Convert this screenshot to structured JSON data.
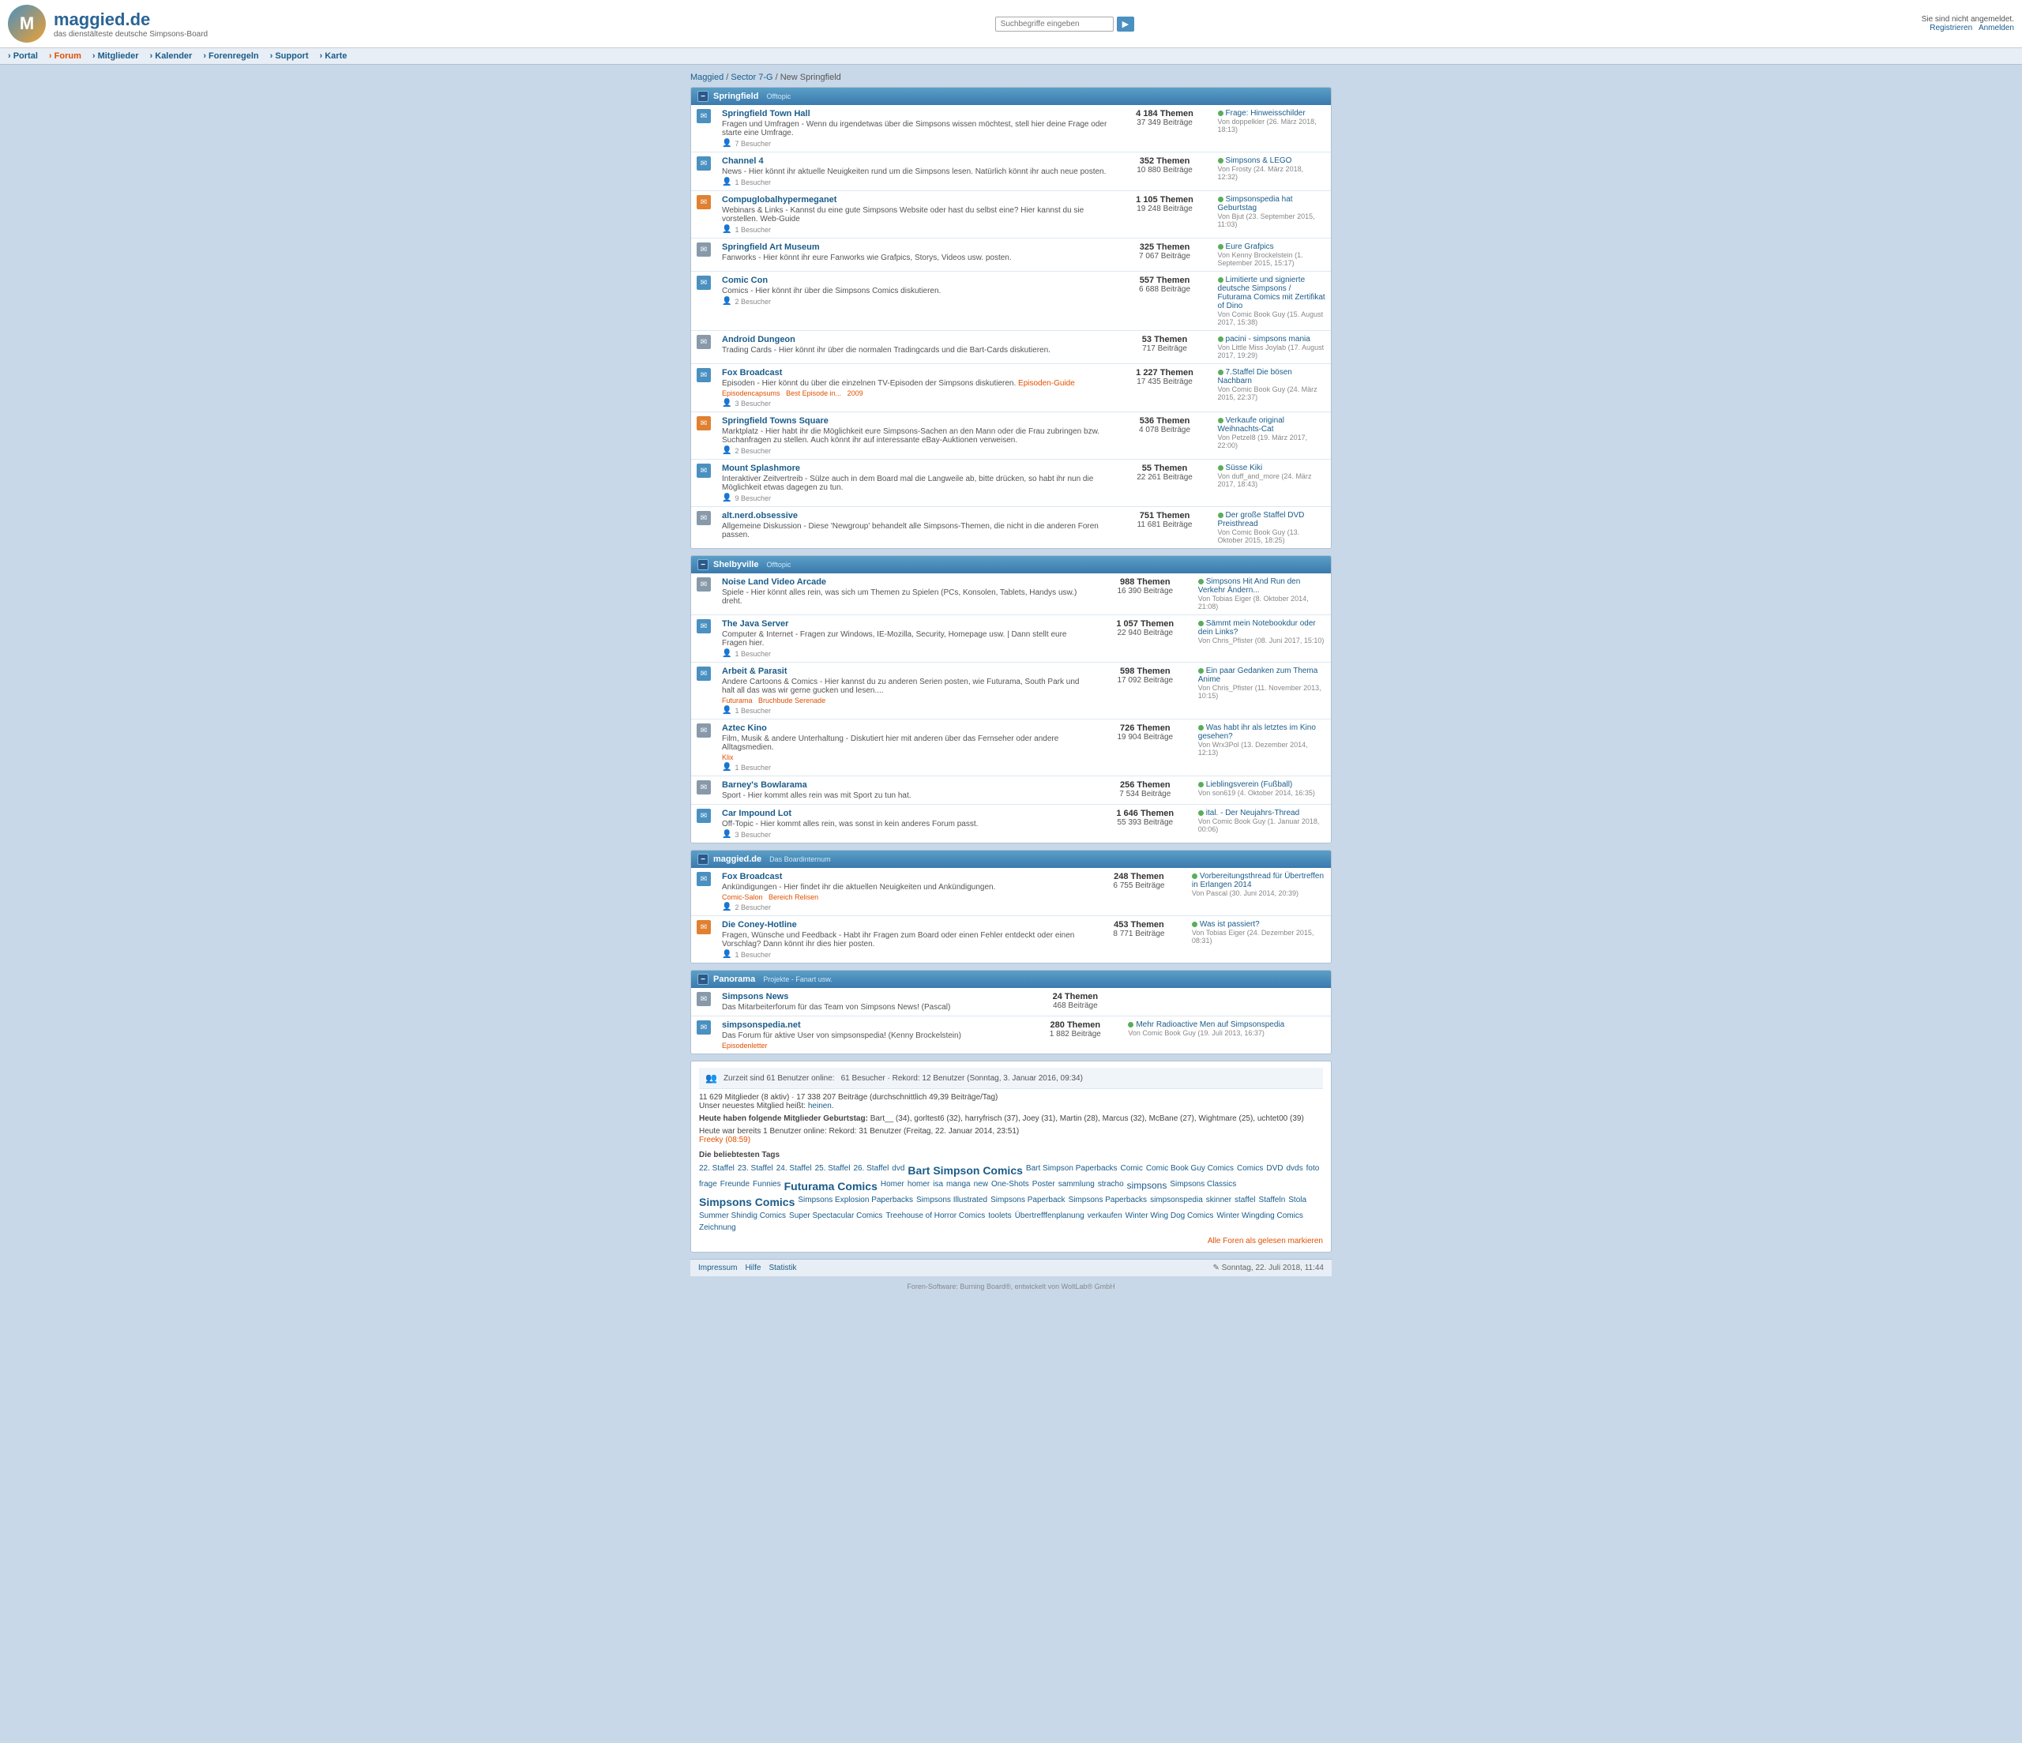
{
  "site": {
    "title": "maggied.de",
    "subtitle": "das dienstälteste deutsche Simpsons-Board",
    "search_placeholder": "Suchbegriffe eingeben",
    "not_logged_in": "Sie sind nicht angemeldet.",
    "register_link": "Registrieren",
    "login_link": "Anmelden"
  },
  "navbar": {
    "items": [
      {
        "label": "Portal",
        "href": "#",
        "active": false
      },
      {
        "label": "Forum",
        "href": "#",
        "active": true
      },
      {
        "label": "Mitglieder",
        "href": "#",
        "active": false
      },
      {
        "label": "Kalender",
        "href": "#",
        "active": false
      },
      {
        "label": "Forenregeln",
        "href": "#",
        "active": false
      },
      {
        "label": "Support",
        "href": "#",
        "active": false
      },
      {
        "label": "Karte",
        "href": "#",
        "active": false
      }
    ]
  },
  "breadcrumb": {
    "items": [
      "Maggied",
      "Sector 7-G",
      "New Springfield"
    ]
  },
  "categories": [
    {
      "id": "springfield",
      "name": "Springfield",
      "subtitle": "Offtopic",
      "forums": [
        {
          "name": "Springfield Town Hall",
          "desc": "Fragen und Umfragen - Wenn du irgendetwas über die Simpsons wissen möchtest, stell hier deine Frage oder starte eine Umfrage.",
          "users": "7 Besucher",
          "topics": "4 184 Themen",
          "posts": "37 349 Beiträge",
          "last_post_title": "Frage: Hinweisschilder",
          "last_post_meta": "Von doppelkler (26. März 2018, 18:13)"
        },
        {
          "name": "Channel 4",
          "desc": "News - Hier könnt ihr aktuelle Neuigkeiten rund um die Simpsons lesen. Natürlich könnt ihr auch neue posten.",
          "users": "1 Besucher",
          "topics": "352 Themen",
          "posts": "10 880 Beiträge",
          "last_post_title": "Simpsons & LEGO",
          "last_post_meta": "Von Frosty (24. März 2018, 12:32)"
        },
        {
          "name": "Compuglobalhypermeganet",
          "desc": "Webinars & Links - Kannst du eine gute Simpsons Website oder hast du selbst eine? Hier kannst du sie vorstellen. Web-Guide",
          "users": "1 Besucher",
          "topics": "1 105 Themen",
          "posts": "19 248 Beiträge",
          "last_post_title": "Simpsonspedia hat Geburtstag",
          "last_post_meta": "Von Bjut (23. September 2015, 11:03)"
        },
        {
          "name": "Springfield Art Museum",
          "desc": "Fanworks - Hier könnt ihr eure Fanworks wie Grafpics, Storys, Videos usw. posten.",
          "users": "",
          "topics": "325 Themen",
          "posts": "7 067 Beiträge",
          "last_post_title": "Eure Grafpics",
          "last_post_meta": "Von Kenny Brockelstein (1. September 2015, 15:17)"
        },
        {
          "name": "Comic Con",
          "desc": "Comics - Hier könnt ihr über die Simpsons Comics diskutieren.",
          "users": "2 Besucher",
          "topics": "557 Themen",
          "posts": "6 688 Beiträge",
          "last_post_title": "Limitierte und signierte deutsche Simpsons / Futurama Comics mit Zertifikat of Dino",
          "last_post_meta": "Von Comic Book Guy (15. August 2017, 15:38)"
        },
        {
          "name": "Android Dungeon",
          "desc": "Trading Cards - Hier könnt ihr über die normalen Tradingcards und die Bart-Cards diskutieren.",
          "users": "",
          "topics": "53 Themen",
          "posts": "717 Beiträge",
          "last_post_title": "pacini - simpsons mania",
          "last_post_meta": "Von Little Miss Joylab (17. August 2017, 19:29)"
        },
        {
          "name": "Fox Broadcast",
          "desc": "Episoden - Hier könnt du über die einzelnen TV-Episoden der Simpsons diskutieren. Episoden-Guide",
          "users": "3 Besucher",
          "topics": "1 227 Themen",
          "posts": "17 435 Beiträge",
          "last_post_title": "7.Staffel Die bösen Nachbarn",
          "last_post_meta": "Von Comic Book Guy (24. März 2015, 22:37)",
          "sub_links": [
            "Episodencapsums",
            "Best Episode in...",
            "2009"
          ]
        },
        {
          "name": "Springfield Towns Square",
          "desc": "Marktplatz - Hier habt ihr die Möglichkeit eure Simpsons-Sachen an den Mann oder die Frau zubringen bzw. Suchanfragen zu stellen. Auch könnt ihr auf interessante eBay-Auktionen verweisen.",
          "users": "2 Besucher",
          "topics": "536 Themen",
          "posts": "4 078 Beiträge",
          "last_post_title": "Verkaufe original Weihnachts-Cat",
          "last_post_meta": "Von Petzel8 (19. März 2017, 22:00)"
        },
        {
          "name": "Mount Splashmore",
          "desc": "Interaktiver Zeitvertreib - Sülze auch in dem Board mal die Langweile ab, bitte drücken, so habt ihr nun die Möglichkeit etwas dagegen zu tun.",
          "users": "9 Besucher",
          "topics": "55 Themen",
          "posts": "22 261 Beiträge",
          "last_post_title": "Süsse Kiki",
          "last_post_meta": "Von duff_and_more (24. März 2017, 18:43)"
        },
        {
          "name": "alt.nerd.obsessive",
          "desc": "Allgemeine Diskussion - Diese 'Newgroup' behandelt alle Simpsons-Themen, die nicht in die anderen Foren passen.",
          "users": "",
          "topics": "751 Themen",
          "posts": "11 681 Beiträge",
          "last_post_title": "Der große Staffel DVD Preisthread",
          "last_post_meta": "Von Comic Book Guy (13. Oktober 2015, 18:25)"
        }
      ]
    },
    {
      "id": "shelbyville",
      "name": "Shelbyville",
      "subtitle": "Offtopic",
      "forums": [
        {
          "name": "Noise Land Video Arcade",
          "desc": "Spiele - Hier könnt alles rein, was sich um Themen zu Spielen (PCs, Konsolen, Tablets, Handys usw.) dreht.",
          "users": "",
          "topics": "988 Themen",
          "posts": "16 390 Beiträge",
          "last_post_title": "Simpsons Hit And Run den Verkehr Ändern und die Leute neu rumzulfen in Charaktere ändern",
          "last_post_meta": "Von Tobias Eiger (8. Oktober 2014, 21:08)"
        },
        {
          "name": "The Java Server",
          "desc": "Computer & Internet - Fragen zur Windows, IE-Mozilla, Security, Homepage usw. | Dann stellt eure Fragen hier.",
          "users": "1 Besucher",
          "topics": "1 057 Themen",
          "posts": "22 940 Beiträge",
          "last_post_title": "Sämmt mein Notebookdur oder dein Links?",
          "last_post_meta": "Von Chris_Pfister (08. Juni 2017, 15:10)"
        },
        {
          "name": "Arbeit & Parasit",
          "desc": "Andere Cartoons & Comics - Hier kannst du zu anderen Serien posten, wie Futurama, South Park und halt all das was wir gerne gucken und lesen....",
          "users": "1 Besucher",
          "topics": "598 Themen",
          "posts": "17 092 Beiträge",
          "last_post_title": "Ein paar Gedanken zum Thema Anime",
          "last_post_meta": "Von Chris_Pfister (11. November 2013, 10:15)",
          "sub_links": [
            "Futurama",
            "Bruchbude Serenade"
          ]
        },
        {
          "name": "Aztec Kino",
          "desc": "Film, Musik & andere Unterhaltung - Diskutiert hier mit anderen über das Fernseher oder andere Alltagsmedien.",
          "users": "1 Besucher",
          "topics": "726 Themen",
          "posts": "19 904 Beiträge",
          "last_post_title": "Was habt ihr als letztes im Kino gesehen?",
          "last_post_meta": "Von Wrx3Pol (13. Dezember 2014, 12:13)",
          "sub_links": [
            "Klix"
          ]
        },
        {
          "name": "Barney's Bowlarama",
          "desc": "Sport - Hier kommt alles rein was mit Sport zu tun hat.",
          "users": "",
          "topics": "256 Themen",
          "posts": "7 534 Beiträge",
          "last_post_title": "Lieblingsverein (Fußball)",
          "last_post_meta": "Von son619 (4. Oktober 2014, 16:35)"
        },
        {
          "name": "Car Impound Lot",
          "desc": "Off-Topic - Hier kommt alles rein, was sonst in kein anderes Forum passt.",
          "users": "3 Besucher",
          "topics": "1 646 Themen",
          "posts": "55 393 Beiträge",
          "last_post_title": "ital. - Der Neujahrs-Thread",
          "last_post_meta": "Von Comic Book Guy (1. Januar 2018, 00:06)"
        }
      ]
    },
    {
      "id": "maggied",
      "name": "maggied.de",
      "subtitle": "Das Boardinternum",
      "forums": [
        {
          "name": "Fox Broadcast",
          "desc": "Ankündigungen - Hier findet ihr die aktuellen Neuigkeiten und Ankündigungen.",
          "users": "2 Besucher",
          "topics": "248 Themen",
          "posts": "6 755 Beiträge",
          "last_post_title": "Vorbereitungsthread für Übertreffen in Erlangen 2014",
          "last_post_meta": "Von Pascal (30. Juni 2014, 20:39)",
          "sub_links": [
            "Comic-Salon",
            "Bereich Relisen"
          ]
        },
        {
          "name": "Die Coney-Hotline",
          "desc": "Fragen, Wünsche und Feedback - Habt ihr Fragen zum Board oder einen Fehler entdeckt oder einen Vorschlag? Dann könnt ihr dies hier posten.",
          "users": "1 Besucher",
          "topics": "453 Themen",
          "posts": "8 771 Beiträge",
          "last_post_title": "Was ist passiert?",
          "last_post_meta": "Von Tobias Eiger (24. Dezember 2015, 08:31)"
        }
      ]
    },
    {
      "id": "panorama",
      "name": "Panorama",
      "subtitle": "Projekte - Fanart usw.",
      "forums": [
        {
          "name": "Simpsons News",
          "desc": "Das Mitarbeiterforum für das Team von Simpsons News! (Pascal)",
          "users": "",
          "topics": "24 Themen",
          "posts": "468 Beiträge",
          "last_post_title": "",
          "last_post_meta": ""
        },
        {
          "name": "simpsonspedia.net",
          "desc": "Das Forum für aktive User von simpsonspedia! (Kenny Brockelstein)",
          "users": "",
          "topics": "280 Themen",
          "posts": "1 882 Beiträge",
          "last_post_title": "Mehr Radioactive Men auf Simpsonspedia",
          "last_post_meta": "Von Comic Book Guy (19. Juli 2013, 16:37)",
          "sub_links": [
            "Episodenletter"
          ]
        }
      ]
    }
  ],
  "stats": {
    "online_now": "Zurzeit sind 61 Benutzer online:",
    "online_detail": "61 Besucher · Rekord: 12 Benutzer (Sonntag, 3. Januar 2016, 09:34)",
    "members": "11 629 Mitglieder (8 aktiv) · 17 338 207 Beiträge (durchschnittlich 49,39 Beiträge/Tag)",
    "newest": "Unser neuestes Mitglied heißt: heinen.",
    "birthdays_label": "Heute haben folgende Mitglieder Geburtstag:",
    "birthdays": "Bart__ (34), gorltest6 (32), harryfrisch (37), Joey (31), Martin (28), Marcus (32), McBane (27), Wightmare (25), uchtet00 (39)",
    "today_users_label": "Heute war bereits 1 Benutzer online:",
    "today_users_detail": "Rekord: 31 Benutzer (Freitag, 22. Januar 2014, 23:51)",
    "today_user_link": "Freeky (08:59)",
    "popular_tags_label": "Die beliebtesten Tags",
    "tags": [
      {
        "text": "22. Staffel",
        "size": "normal"
      },
      {
        "text": "23. Staffel",
        "size": "normal"
      },
      {
        "text": "24. Staffel",
        "size": "normal"
      },
      {
        "text": "25. Staffel",
        "size": "normal"
      },
      {
        "text": "26. Staffel",
        "size": "normal"
      },
      {
        "text": "dvd",
        "size": "normal"
      },
      {
        "text": "Bart Simpson Comics",
        "size": "big"
      },
      {
        "text": "Bart Simpson Paperbacks",
        "size": "normal"
      },
      {
        "text": "Comic",
        "size": "normal"
      },
      {
        "text": "Comic Book Guy Comics",
        "size": "normal"
      },
      {
        "text": "Comics",
        "size": "normal"
      },
      {
        "text": "DVD",
        "size": "normal"
      },
      {
        "text": "dvds",
        "size": "normal"
      },
      {
        "text": "foto",
        "size": "normal"
      },
      {
        "text": "frage",
        "size": "normal"
      },
      {
        "text": "Freunde",
        "size": "normal"
      },
      {
        "text": "Funnies",
        "size": "normal"
      },
      {
        "text": "Futurama Comics",
        "size": "big"
      },
      {
        "text": "Homer",
        "size": "normal"
      },
      {
        "text": "homer",
        "size": "normal"
      },
      {
        "text": "isa",
        "size": "normal"
      },
      {
        "text": "manga",
        "size": "normal"
      },
      {
        "text": "new",
        "size": "normal"
      },
      {
        "text": "One-Shots",
        "size": "normal"
      },
      {
        "text": "Poster",
        "size": "normal"
      },
      {
        "text": "sammlung",
        "size": "normal"
      },
      {
        "text": "stracho",
        "size": "normal"
      },
      {
        "text": "simpsons",
        "size": "medium"
      },
      {
        "text": "Simpsons Classics",
        "size": "normal"
      },
      {
        "text": "Simpsons Comics",
        "size": "big"
      },
      {
        "text": "Simpsons Explosion Paperbacks",
        "size": "normal"
      },
      {
        "text": "Simpsons Illustrated",
        "size": "normal"
      },
      {
        "text": "Simpsons Paperback",
        "size": "normal"
      },
      {
        "text": "Simpsons Paperbacks",
        "size": "normal"
      },
      {
        "text": "simpsonspedia",
        "size": "normal"
      },
      {
        "text": "skinner",
        "size": "normal"
      },
      {
        "text": "staffel",
        "size": "normal"
      },
      {
        "text": "Staffeln",
        "size": "normal"
      },
      {
        "text": "Stola",
        "size": "normal"
      },
      {
        "text": "Summer Shindig Comics",
        "size": "normal"
      },
      {
        "text": "Super Spectacular Comics",
        "size": "normal"
      },
      {
        "text": "Treehouse of Horror Comics",
        "size": "normal"
      },
      {
        "text": "toolets",
        "size": "normal"
      },
      {
        "text": "Übertrefffenplanung",
        "size": "normal"
      },
      {
        "text": "verkaufen",
        "size": "normal"
      },
      {
        "text": "Winter Wing Dog Comics",
        "size": "normal"
      },
      {
        "text": "Winter Wingding Comics",
        "size": "normal"
      },
      {
        "text": "Zeichnung",
        "size": "normal"
      }
    ],
    "mark_all": "Alle Foren als gelesen markieren"
  },
  "footer": {
    "impressum": "Impressum",
    "hilfe": "Hilfe",
    "statistik": "Statistik",
    "stift_icon": "✎",
    "datetime": "Sonntag, 22. Juli 2018, 11:44",
    "powered_by": "Foren-Software: Burning Board®, entwickelt von WoltLab® GmbH"
  }
}
